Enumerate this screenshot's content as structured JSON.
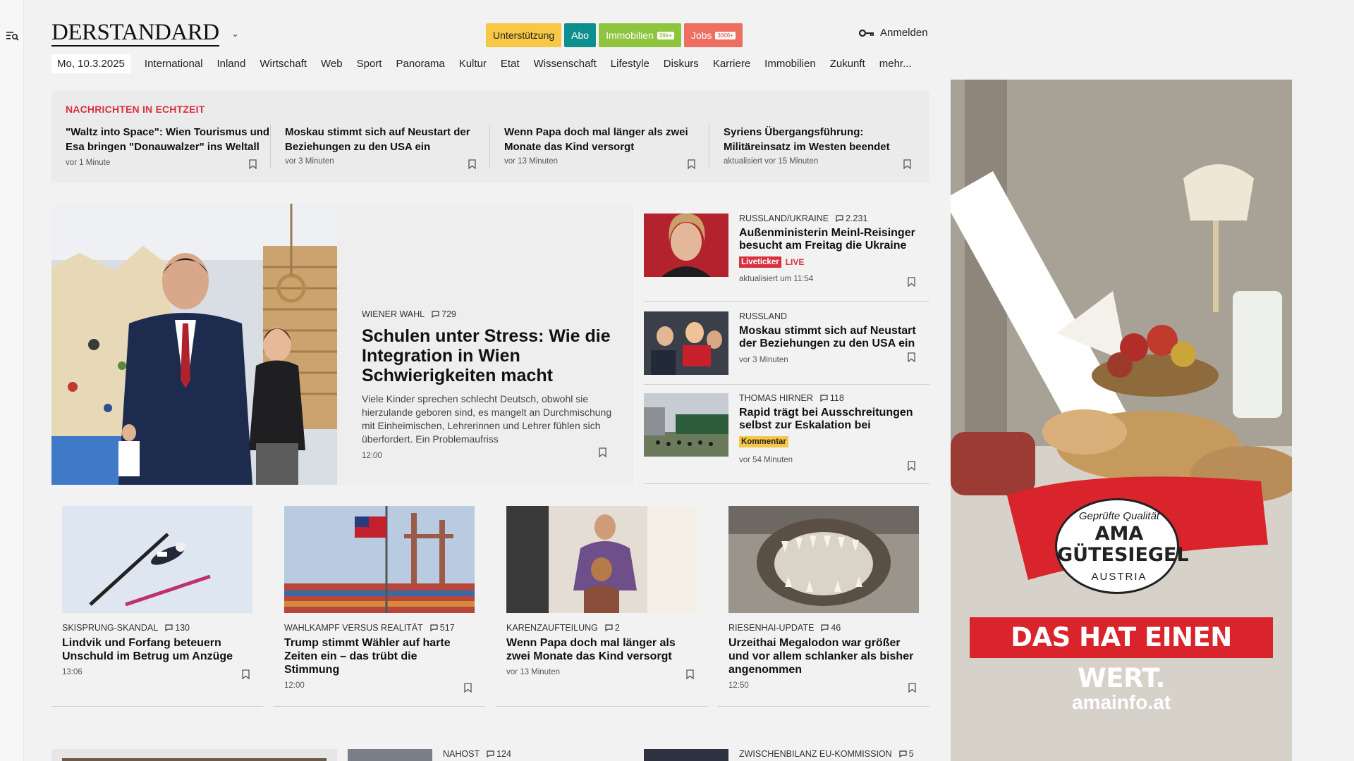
{
  "header": {
    "logo": "DERSTANDARD",
    "pills": {
      "support": "Unterstützung",
      "abo": "Abo",
      "immo": "Immobilien",
      "immo_tag": "30k+",
      "jobs": "Jobs",
      "jobs_tag": "3000+"
    },
    "login": "Anmelden"
  },
  "nav": {
    "date": "Mo, 10.3.2025",
    "items": [
      "International",
      "Inland",
      "Wirtschaft",
      "Web",
      "Sport",
      "Panorama",
      "Kultur",
      "Etat",
      "Wissenschaft",
      "Lifestyle",
      "Diskurs",
      "Karriere",
      "Immobilien",
      "Zukunft",
      "mehr..."
    ]
  },
  "ticker": {
    "title": "Nachrichten in Echtzeit",
    "items": [
      {
        "title": "\"Waltz into Space\": Wien Tourismus und Esa bringen \"Donauwalzer\" ins Weltall",
        "meta": "vor 1 Minute"
      },
      {
        "title": "Moskau stimmt sich auf Neustart der Beziehungen zu den USA ein",
        "meta": "vor 3 Minuten"
      },
      {
        "title": "Wenn Papa doch mal länger als zwei Monate das Kind versorgt",
        "meta": "vor 13 Minuten"
      },
      {
        "title": "Syriens Übergangsführung: Militäreinsatz im Westen beendet",
        "meta": "aktualisiert vor 15 Minuten"
      }
    ]
  },
  "hero": {
    "kicker": "Wiener Wahl",
    "comments": "729",
    "title": "Schulen unter Stress: Wie die Integration in Wien Schwierigkeiten macht",
    "teaser": "Viele Kinder sprechen schlecht Deutsch, obwohl sie hierzulande geboren sind, es mangelt an Durchmischung mit Einheimischen, Lehrerinnen und Lehrer fühlen sich überfordert. Ein Problemaufriss",
    "time": "12:00"
  },
  "side": [
    {
      "kicker": "Russland/Ukraine",
      "comments": "2.231",
      "title": "Außenministerin Meinl-Reisinger besucht am Freitag die Ukraine",
      "badge": "Liveticker",
      "badge2": "LIVE",
      "meta": "aktualisiert um 11:54"
    },
    {
      "kicker": "Russland",
      "comments": "",
      "title": "Moskau stimmt sich auf Neustart der Beziehungen zu den USA ein",
      "meta": "vor 3 Minuten"
    },
    {
      "kicker": "Thomas Hirner",
      "comments": "118",
      "title": "Rapid trägt bei Ausschreitungen selbst zur Eskalation bei",
      "badge": "Kommentar",
      "meta": "vor 54 Minuten"
    }
  ],
  "cards": [
    {
      "kicker": "Skisprung-Skandal",
      "comments": "130",
      "title": "Lindvik und Forfang beteuern Unschuld im Betrug um Anzüge",
      "meta": "13:06"
    },
    {
      "kicker": "Wahlkampf versus Realität",
      "comments": "517",
      "title": "Trump stimmt Wähler auf harte Zeiten ein – das trübt die Stimmung",
      "meta": "12:00"
    },
    {
      "kicker": "Karenzaufteilung",
      "comments": "2",
      "title": "Wenn Papa doch mal länger als zwei Monate das Kind versorgt",
      "meta": "vor 13 Minuten"
    },
    {
      "kicker": "Riesenhai-Update",
      "comments": "46",
      "title": "Urzeithai Megalodon war größer und vor allem schlanker als bisher angenommen",
      "meta": "12:50"
    }
  ],
  "peek": [
    {
      "kicker": "Nahost",
      "comments": "124"
    },
    {
      "kicker": "Zwischenbilanz EU-Kommission",
      "comments": "5"
    }
  ],
  "ad": {
    "seal_top": "Geprüfte Qualität",
    "seal_main_1": "AMA",
    "seal_main_2": "GÜTESIEGEL",
    "seal_bottom": "AUSTRIA",
    "slogan": "DAS HAT EINEN WERT.",
    "url": "amainfo.at"
  },
  "icons": [
    "menu-search-icon",
    "chevron-down-icon",
    "key-icon",
    "comment-icon",
    "bookmark-icon"
  ],
  "colors": {
    "accent_red": "#d9303e",
    "support": "#f7c845",
    "abo": "#0e8f8f",
    "immo": "#8fc43f",
    "jobs": "#ee6f61"
  }
}
